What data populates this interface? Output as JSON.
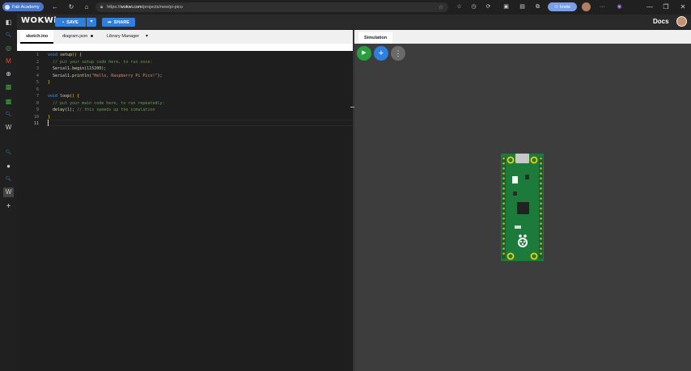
{
  "browser": {
    "profile_label": "Fab Academy",
    "url_prefix": "https://",
    "url_domain": "wokwi.com",
    "url_path": "/projects/new/pi-pico",
    "invite_label": "Invite",
    "window_minimize": "—",
    "window_restore": "❐",
    "window_close": "✕"
  },
  "header": {
    "logo": "WOKWi",
    "save_label": "SAVE",
    "share_label": "SHARE",
    "docs_label": "Docs"
  },
  "editor": {
    "tabs": [
      {
        "label": "sketch.ino",
        "active": true
      },
      {
        "label": "diagram.json",
        "modified": true
      },
      {
        "label": "Library Manager"
      }
    ],
    "lines": [
      {
        "n": "1"
      },
      {
        "n": "2"
      },
      {
        "n": "3"
      },
      {
        "n": "4"
      },
      {
        "n": "5"
      },
      {
        "n": "6"
      },
      {
        "n": "7"
      },
      {
        "n": "8"
      },
      {
        "n": "9"
      },
      {
        "n": "10"
      },
      {
        "n": "11"
      }
    ],
    "code": {
      "l1_kw": "void",
      "l1_fn": "setup",
      "l1_rest": "() {",
      "l2_cm": "  // put your setup code here, to run once:",
      "l3_obj": "  Serial1",
      "l3_fn": ".begin",
      "l3_num": "115200",
      "l3_end": ");",
      "l4_obj": "  Serial1",
      "l4_fn": ".println",
      "l4_str": "\"Hello, Raspberry Pi Pico!\"",
      "l4_end": ");",
      "l5": "}",
      "l7_kw": "void",
      "l7_fn": "loop",
      "l7_rest": "() {",
      "l8_cm": "  // put your main code here, to run repeatedly:",
      "l9_fn": "  delay",
      "l9_num": "1",
      "l9_end": "); ",
      "l9_cm": "// this speeds up the simulation",
      "l10": "}"
    }
  },
  "simulation": {
    "tab_label": "Simulation",
    "play_icon": "▶",
    "add_icon": "+",
    "more_icon": "⋮",
    "board": "Raspberry Pi Pico"
  },
  "colors": {
    "accent": "#2f7fdf",
    "play": "#2a9d3f",
    "pico_green": "#1c7a3a"
  }
}
